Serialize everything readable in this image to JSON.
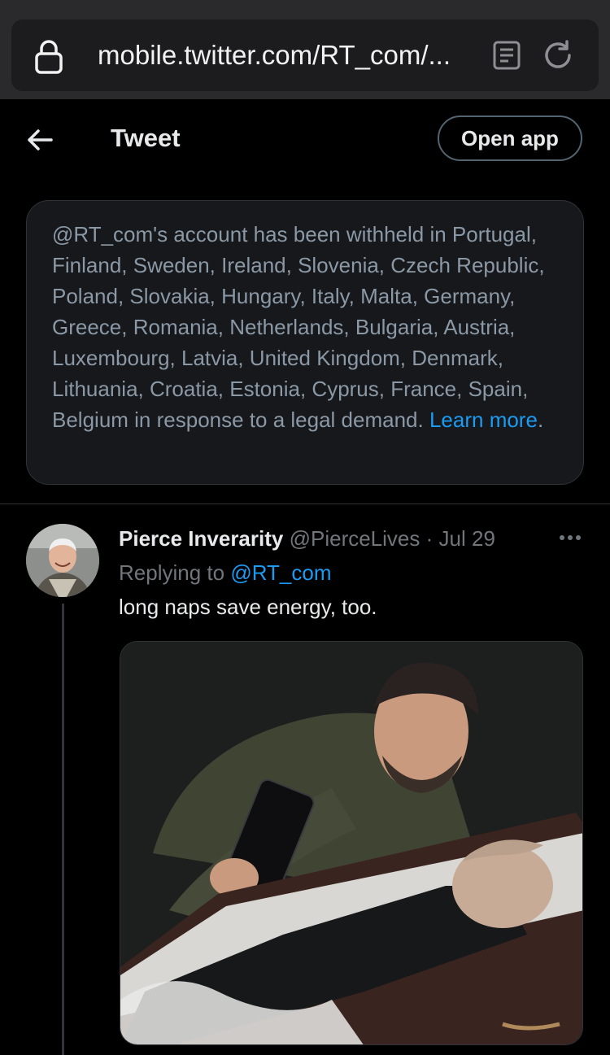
{
  "browser": {
    "url": "mobile.twitter.com/RT_com/...",
    "icons": [
      "lock-icon",
      "reader-icon",
      "reload-icon"
    ]
  },
  "header": {
    "title": "Tweet",
    "open_app_label": "Open app",
    "back_icon": "back-arrow-icon"
  },
  "notice": {
    "text": "@RT_com's account has been withheld in Portugal, Finland, Sweden, Ireland, Slovenia, Czech Republic, Poland, Slovakia, Hungary, Italy, Malta, Germany, Greece, Romania, Netherlands, Bulgaria, Austria, Luxembourg, Latvia, United Kingdom, Denmark, Lithuania, Croatia, Estonia, Cyprus, France, Spain, Belgium in response to a legal demand.",
    "link_label": "Learn more",
    "trailing": "."
  },
  "tweet": {
    "author_name": "Pierce Inverarity",
    "author_handle": "@PierceLives",
    "separator": "·",
    "date": "Jul 29",
    "replying_prefix": "Replying to",
    "replying_to": "@RT_com",
    "text": "long naps save energy, too.",
    "more_icon": "more-options-icon"
  },
  "colors": {
    "background": "#000000",
    "link": "#1d9bf0",
    "muted": "#71767b",
    "text": "#e7e9ea"
  }
}
